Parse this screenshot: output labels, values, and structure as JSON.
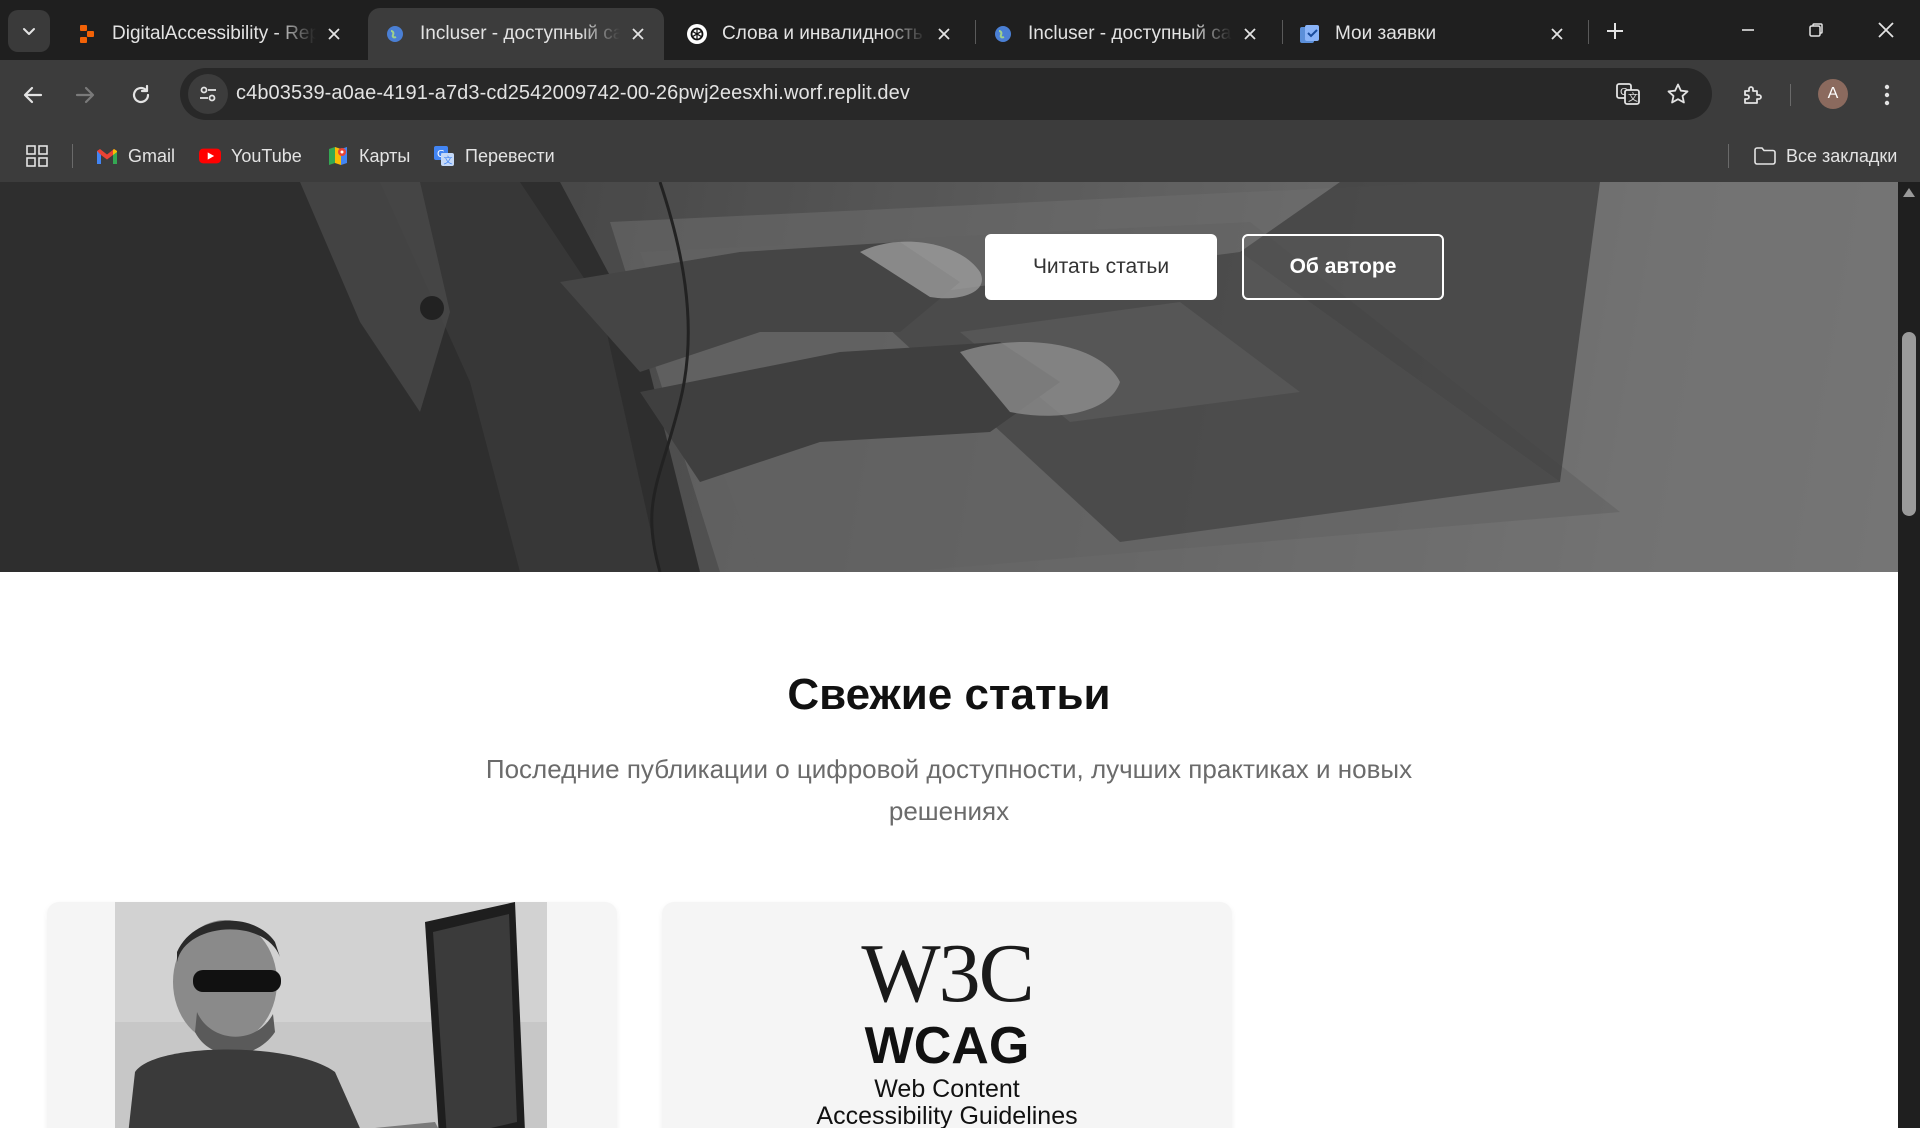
{
  "browser": {
    "tabs": [
      {
        "title": "DigitalAccessibility - Repl",
        "icon": "replit-icon",
        "active": false
      },
      {
        "title": "Incluser - доступный сай",
        "icon": "globe-icon",
        "active": true
      },
      {
        "title": "Слова и инвалидность",
        "icon": "openai-icon",
        "active": false
      },
      {
        "title": "Incluser - доступный сай",
        "icon": "globe-icon",
        "active": false
      },
      {
        "title": "Мои заявки",
        "icon": "tasks-icon",
        "active": false
      }
    ],
    "url": "c4b03539-a0ae-4191-a7d3-cd2542009742-00-26pwj2eesxhi.worf.replit.dev",
    "avatar_letter": "A",
    "bookmarks": [
      {
        "label": "Gmail",
        "icon": "gmail-icon"
      },
      {
        "label": "YouTube",
        "icon": "youtube-icon"
      },
      {
        "label": "Карты",
        "icon": "maps-icon"
      },
      {
        "label": "Перевести",
        "icon": "translate-icon"
      }
    ],
    "all_bookmarks_label": "Все закладки",
    "colors": {
      "chrome_dark": "#1f1f1f",
      "toolbar": "#3c3c3c",
      "omnibox": "#282828"
    }
  },
  "page": {
    "hero": {
      "primary_button": "Читать статьи",
      "secondary_button": "Об авторе"
    },
    "fresh": {
      "title": "Свежие статьи",
      "subtitle": "Последние публикации о цифровой доступности, лучших практиках и новых решениях"
    },
    "cards": [
      {
        "image": "man-with-sunglasses-at-computer-photo"
      },
      {
        "image": "w3c-wcag-logo",
        "logo_text": "W3C",
        "heading": "WCAG",
        "caption_line1": "Web Content",
        "caption_line2": "Accessibility Guidelines"
      }
    ]
  }
}
